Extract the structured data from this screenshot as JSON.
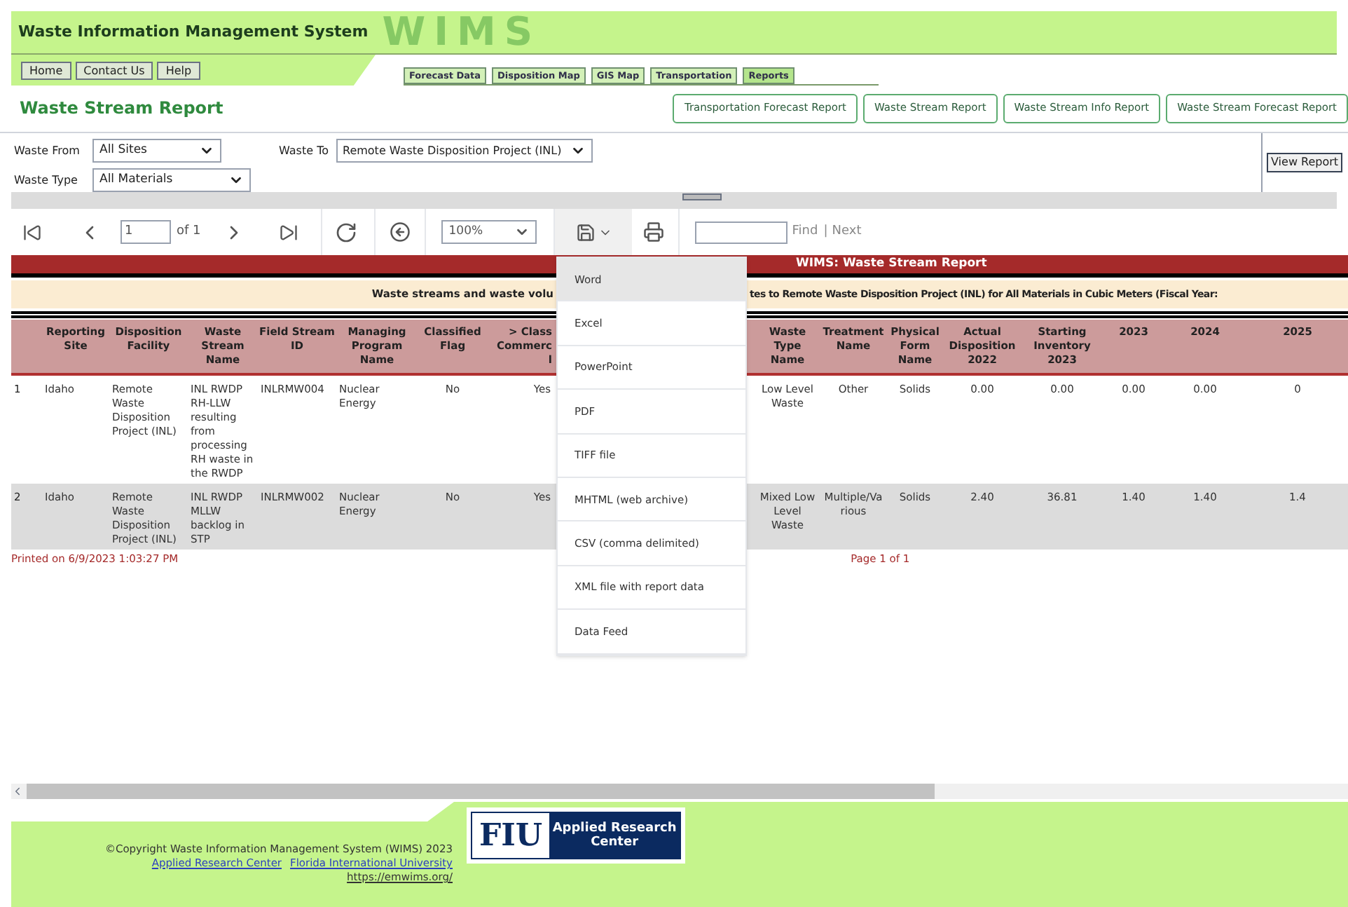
{
  "header": {
    "title": "Waste Information Management System",
    "logo_text": "WIMS"
  },
  "nav": [
    "Home",
    "Contact Us",
    "Help"
  ],
  "tabs": [
    {
      "label": "Forecast Data",
      "selected": false
    },
    {
      "label": "Disposition Map",
      "selected": false
    },
    {
      "label": "GIS Map",
      "selected": false
    },
    {
      "label": "Transportation",
      "selected": false
    },
    {
      "label": "Reports",
      "selected": true
    }
  ],
  "page_title": "Waste Stream Report",
  "report_buttons": [
    "Transportation Forecast Report",
    "Waste Stream Report",
    "Waste Stream Info Report",
    "Waste Stream Forecast Report"
  ],
  "filters": {
    "waste_from": {
      "label": "Waste From",
      "value": "All Sites"
    },
    "waste_to": {
      "label": "Waste To",
      "value": "Remote Waste Disposition Project (INL)"
    },
    "waste_type": {
      "label": "Waste Type",
      "value": "All Materials"
    },
    "view_button": "View Report"
  },
  "toolbar": {
    "page": "1",
    "page_count": "of 1",
    "zoom": "100%",
    "find": "Find",
    "separator": "|",
    "next": "Next"
  },
  "report": {
    "title": "WIMS: Waste Stream Report",
    "subtitle_left": "Waste streams and waste volu",
    "subtitle_right": "tes to Remote Waste Disposition Project (INL) for All Materials  in Cubic Meters (Fiscal Year:",
    "columns": [
      {
        "label": "Reporting Site",
        "kind": "text"
      },
      {
        "label": "Disposition Facility",
        "kind": "text"
      },
      {
        "label": "Waste Stream Name",
        "kind": "text"
      },
      {
        "label": "Field Stream ID",
        "kind": "text"
      },
      {
        "label": "Managing Program Name",
        "kind": "text"
      },
      {
        "label": "Classified Flag",
        "kind": "center"
      },
      {
        "label": "> Class\nCommerc\nl",
        "kind": "cut"
      },
      {
        "label": "Waste Type Name",
        "kind": "center"
      },
      {
        "label": "Treatment Name",
        "kind": "center"
      },
      {
        "label": "Physical Form Name",
        "kind": "center"
      },
      {
        "label": "Actual Disposition 2022",
        "kind": "center"
      },
      {
        "label": "Starting Inventory 2023",
        "kind": "center"
      },
      {
        "label": "2023",
        "kind": "center"
      },
      {
        "label": "2024",
        "kind": "center"
      },
      {
        "label": "2025",
        "kind": "center"
      }
    ],
    "rows": [
      {
        "number": "1",
        "cells": [
          "Idaho",
          "Remote Waste Disposition Project (INL)",
          "INL RWDP RH-LLW resulting from processing RH waste in the RWDP",
          "INLRMW004",
          "Nuclear Energy",
          "No",
          "Yes",
          "Low Level Waste",
          "Other",
          "Solids",
          "0.00",
          "0.00",
          "0.00",
          "0.00",
          "0"
        ]
      },
      {
        "number": "2",
        "cells": [
          "Idaho",
          "Remote Waste Disposition Project (INL)",
          "INL RWDP MLLW backlog in STP",
          "INLRMW002",
          "Nuclear Energy",
          "No",
          "Yes",
          "Mixed Low Level Waste",
          "Multiple/Various",
          "Solids",
          "2.40",
          "36.81",
          "1.40",
          "1.40",
          "1.4"
        ]
      }
    ],
    "printed": "Printed on 6/9/2023 1:03:27 PM",
    "page_info": "Page 1 of 1"
  },
  "export_menu": [
    {
      "label": "Word",
      "selected": true
    },
    {
      "label": "Excel",
      "selected": false
    },
    {
      "label": "PowerPoint",
      "selected": false
    },
    {
      "label": "PDF",
      "selected": false
    },
    {
      "label": "TIFF file",
      "selected": false
    },
    {
      "label": "MHTML (web archive)",
      "selected": false
    },
    {
      "label": "CSV (comma delimited)",
      "selected": false
    },
    {
      "label": "XML file with report data",
      "selected": false
    },
    {
      "label": "Data Feed",
      "selected": false
    }
  ],
  "footer": {
    "copyright": "©Copyright Waste Information Management System (WIMS) 2023",
    "links": [
      "Applied Research Center",
      "Florida International University"
    ],
    "url": "https://emwims.org/",
    "logo_mark": "FIU",
    "logo_text": "Applied Research Center"
  }
}
